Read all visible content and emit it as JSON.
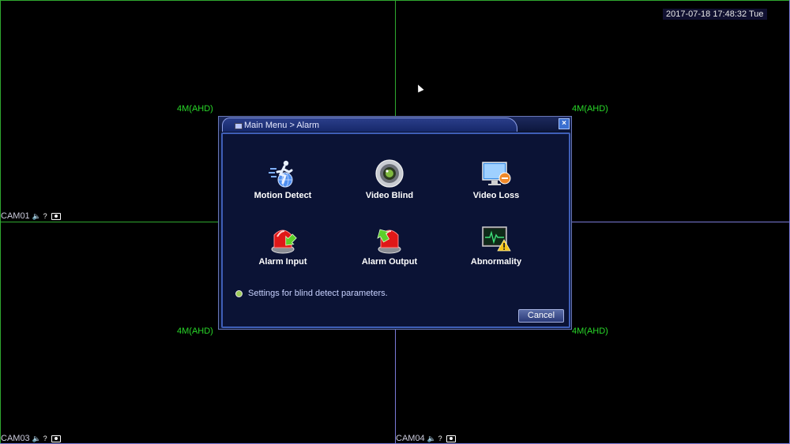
{
  "datetime": "2017-07-18 17:48:32 Tue",
  "channels": [
    {
      "name": "CAM01",
      "resolution": "4M(AHD)"
    },
    {
      "name": "",
      "resolution": "4M(AHD)"
    },
    {
      "name": "CAM03",
      "resolution": "4M(AHD)"
    },
    {
      "name": "CAM04",
      "resolution": "4M(AHD)"
    }
  ],
  "dialog": {
    "title": "Main Menu > Alarm",
    "close_label": "×",
    "items": [
      {
        "label": "Motion Detect",
        "icon": "motion-detect-icon"
      },
      {
        "label": "Video Blind",
        "icon": "video-blind-icon"
      },
      {
        "label": "Video Loss",
        "icon": "video-loss-icon"
      },
      {
        "label": "Alarm Input",
        "icon": "alarm-input-icon"
      },
      {
        "label": "Alarm Output",
        "icon": "alarm-output-icon"
      },
      {
        "label": "Abnormality",
        "icon": "abnormality-icon"
      }
    ],
    "hint": "Settings for blind detect parameters.",
    "cancel_label": "Cancel"
  },
  "colors": {
    "grid_green": "#2fa82f",
    "grid_blue": "#7a7ad8",
    "resolution_text": "#29d929",
    "dialog_bg": "#0b1335",
    "dialog_border": "#3f5fb8"
  }
}
